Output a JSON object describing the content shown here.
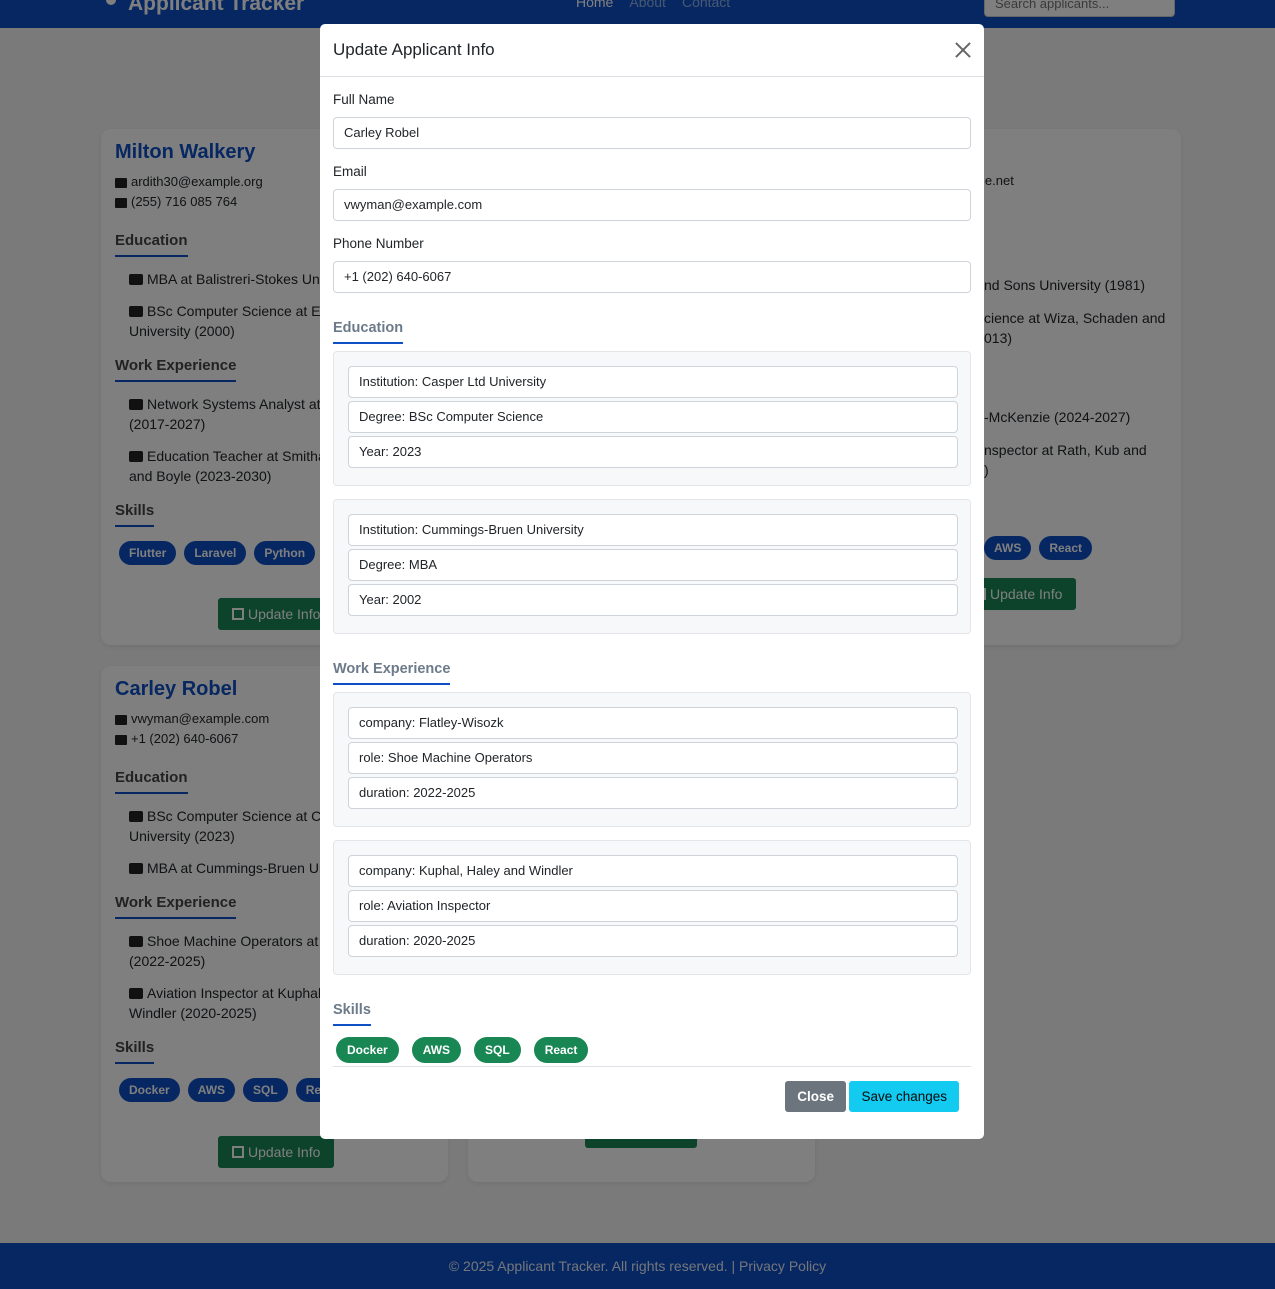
{
  "navbar": {
    "brand": "Applicant Tracker",
    "links": [
      "Home",
      "About",
      "Contact"
    ],
    "search_placeholder": "Search applicants..."
  },
  "cards": {
    "milton": {
      "name": "Milton Walkery",
      "email": "ardith30@example.org",
      "phone": "(255) 716 085 764",
      "education_title": "Education",
      "education": [
        "MBA at Balistreri-Stokes Univ",
        "BSc Computer Science at Em",
        "University (2000)"
      ],
      "work_title": "Work Experience",
      "work": [
        "Network Systems Analyst at E",
        "(2017-2027)",
        "Education Teacher at Smithan",
        "and Boyle (2023-2030)"
      ],
      "skills_title": "Skills",
      "skills": [
        "Flutter",
        "Laravel",
        "Python"
      ],
      "update_label": "Update Info"
    },
    "carley": {
      "name": "Carley Robel",
      "email": "vwyman@example.com",
      "phone": "+1 (202) 640-6067",
      "education_title": "Education",
      "education": [
        "BSc Computer Science at Ca",
        "University (2023)",
        "MBA at Cummings-Bruen Un"
      ],
      "work_title": "Work Experience",
      "work": [
        "Shoe Machine Operators at F",
        "(2022-2025)",
        "Aviation Inspector at Kuphal, I",
        "Windler (2020-2025)"
      ],
      "skills_title": "Skills",
      "skills": [
        "Docker",
        "AWS",
        "SQL",
        "Rea"
      ],
      "update_label": "Update Info"
    },
    "right": {
      "email_fragment": "le.net",
      "education": [
        "nd Sons University (1981)",
        "cience at Wiza, Schaden and",
        "013)"
      ],
      "work": [
        "-McKenzie (2024-2027)",
        "nspector at Rath, Kub and",
        ")"
      ],
      "skills": [
        "AWS",
        "React"
      ],
      "update_label": "Update Info"
    }
  },
  "footer": {
    "text": "© 2025 Applicant Tracker. All rights reserved. | Privacy Policy"
  },
  "modal": {
    "title": "Update Applicant Info",
    "full_name_label": "Full Name",
    "full_name_value": "Carley Robel",
    "email_label": "Email",
    "email_value": "vwyman@example.com",
    "phone_label": "Phone Number",
    "phone_value": "+1 (202) 640-6067",
    "education_title": "Education",
    "education": [
      {
        "institution": "Institution: Casper Ltd University",
        "degree": "Degree: BSc Computer Science",
        "year": "Year: 2023"
      },
      {
        "institution": "Institution: Cummings-Bruen University",
        "degree": "Degree: MBA",
        "year": "Year: 2002"
      }
    ],
    "work_title": "Work Experience",
    "work": [
      {
        "company": "company: Flatley-Wisozk",
        "role": "role: Shoe Machine Operators",
        "duration": "duration: 2022-2025"
      },
      {
        "company": "company: Kuphal, Haley and Windler",
        "role": "role: Aviation Inspector",
        "duration": "duration: 2020-2025"
      }
    ],
    "skills_title": "Skills",
    "skills": [
      "Docker",
      "AWS",
      "SQL",
      "React"
    ],
    "close_label": "Close",
    "save_label": "Save changes"
  }
}
